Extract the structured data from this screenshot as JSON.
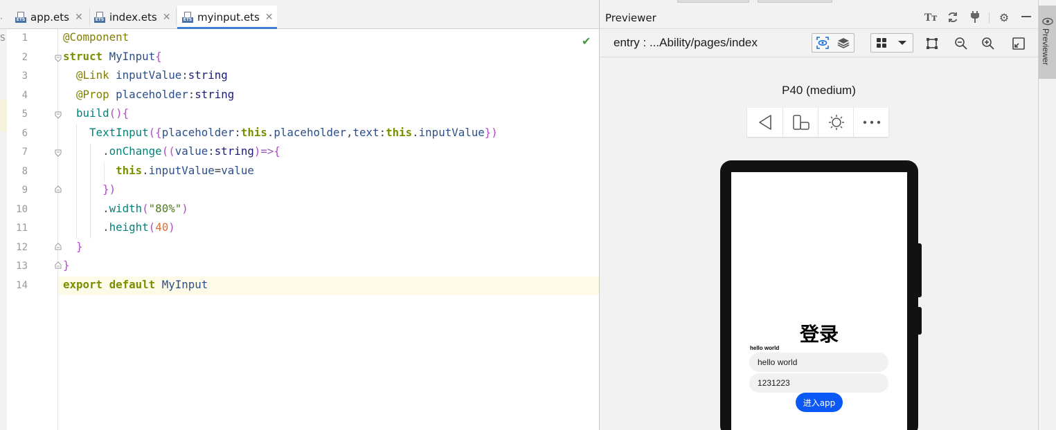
{
  "editor": {
    "tabs": [
      {
        "label": "app.ets",
        "active": false
      },
      {
        "label": "index.ets",
        "active": false
      },
      {
        "label": "myinput.ets",
        "active": true
      }
    ],
    "left_edge_glyph": "S",
    "line_numbers": [
      "1",
      "2",
      "3",
      "4",
      "5",
      "6",
      "7",
      "8",
      "9",
      "10",
      "11",
      "12",
      "13",
      "14"
    ],
    "code_lines": [
      "@Component",
      "struct MyInput{",
      "  @Link inputValue:string",
      "  @Prop placeholder:string",
      "  build(){",
      "    TextInput({placeholder:this.placeholder,text:this.inputValue})",
      "      .onChange((value:string)=>{",
      "        this.inputValue=value",
      "      })",
      "      .width(\"80%\")",
      "      .height(40)",
      "  }",
      "}",
      "export default MyInput"
    ],
    "current_line": 14,
    "inspection_status": "check-icon"
  },
  "previewer": {
    "title": "Previewer",
    "route": "entry : ...Ability/pages/index",
    "device_name": "P40 (medium)",
    "app": {
      "heading": "登录",
      "small_label": "hello world",
      "input1_value": "hello world",
      "input2_value": "1231223",
      "button_label": "进入app"
    },
    "side_tab_label": "Previewer",
    "accent_color": "#0a59f7"
  }
}
